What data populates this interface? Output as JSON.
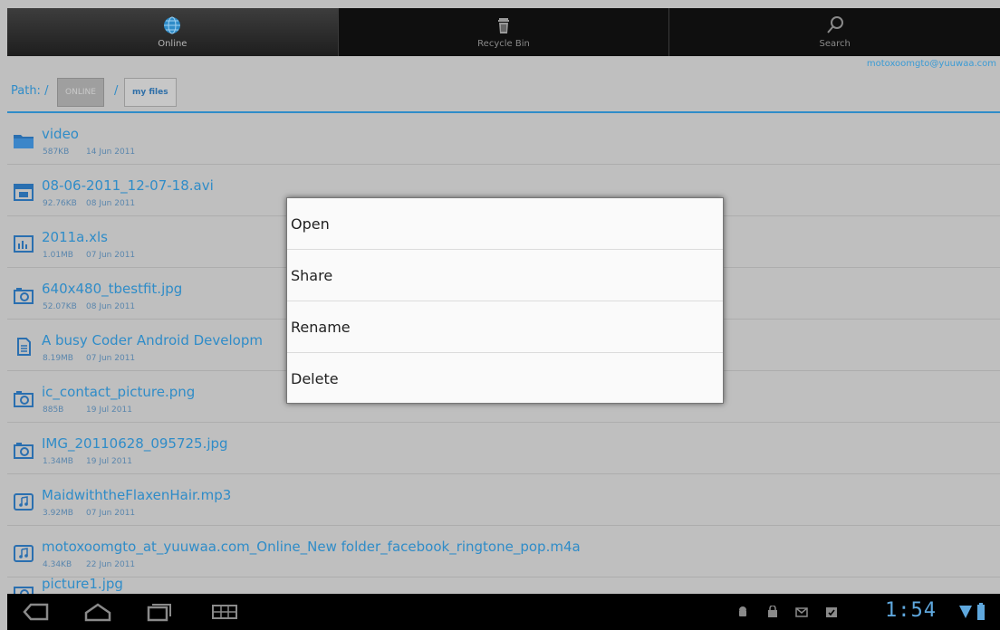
{
  "tabs": [
    {
      "label": "Online",
      "icon": "globe-icon",
      "active": true
    },
    {
      "label": "Recycle Bin",
      "icon": "trash-icon",
      "active": false
    },
    {
      "label": "Search",
      "icon": "search-icon",
      "active": false
    }
  ],
  "account": "motoxoomgto@yuuwaa.com",
  "path": {
    "label": "Path: /",
    "separator": "/",
    "crumbs": [
      "ONLINE",
      "my files"
    ]
  },
  "files": [
    {
      "name": "video",
      "size": "587KB",
      "date": "14 Jun 2011",
      "icon": "folder-icon"
    },
    {
      "name": "08-06-2011_12-07-18.avi",
      "size": "92.76KB",
      "date": "08 Jun 2011",
      "icon": "video-file-icon"
    },
    {
      "name": "2011a.xls",
      "size": "1.01MB",
      "date": "07 Jun 2011",
      "icon": "spreadsheet-file-icon"
    },
    {
      "name": "640x480_tbestfit.jpg",
      "size": "52.07KB",
      "date": "08 Jun 2011",
      "icon": "camera-image-icon"
    },
    {
      "name": "A busy Coder Android Developm",
      "size": "8.19MB",
      "date": "07 Jun 2011",
      "icon": "document-file-icon"
    },
    {
      "name": "ic_contact_picture.png",
      "size": "885B",
      "date": "19 Jul 2011",
      "icon": "camera-image-icon"
    },
    {
      "name": "IMG_20110628_095725.jpg",
      "size": "1.34MB",
      "date": "19 Jul 2011",
      "icon": "camera-image-icon"
    },
    {
      "name": "MaidwiththeFlaxenHair.mp3",
      "size": "3.92MB",
      "date": "07 Jun 2011",
      "icon": "music-file-icon"
    },
    {
      "name": "motoxoomgto_at_yuuwaa.com_Online_New folder_facebook_ringtone_pop.m4a",
      "size": "4.34KB",
      "date": "22 Jun 2011",
      "icon": "music-file-icon"
    },
    {
      "name": "picture1.jpg",
      "size": "",
      "date": "",
      "icon": "camera-image-icon"
    }
  ],
  "context_menu": {
    "items": [
      "Open",
      "Share",
      "Rename",
      "Delete"
    ]
  },
  "system_bar": {
    "clock": "1:54",
    "nav": [
      "back-icon",
      "home-icon",
      "recent-apps-icon",
      "keyboard-icon"
    ],
    "status_icons": [
      "android-debug-icon",
      "shopping-bag-icon",
      "gmail-icon",
      "download-done-icon",
      "wifi-icon",
      "battery-icon"
    ]
  },
  "colors": {
    "accent": "#2f8cc8",
    "list_bg": "#bfbfbf",
    "menu_bg": "#fafafa",
    "bar_bg": "#000000"
  }
}
